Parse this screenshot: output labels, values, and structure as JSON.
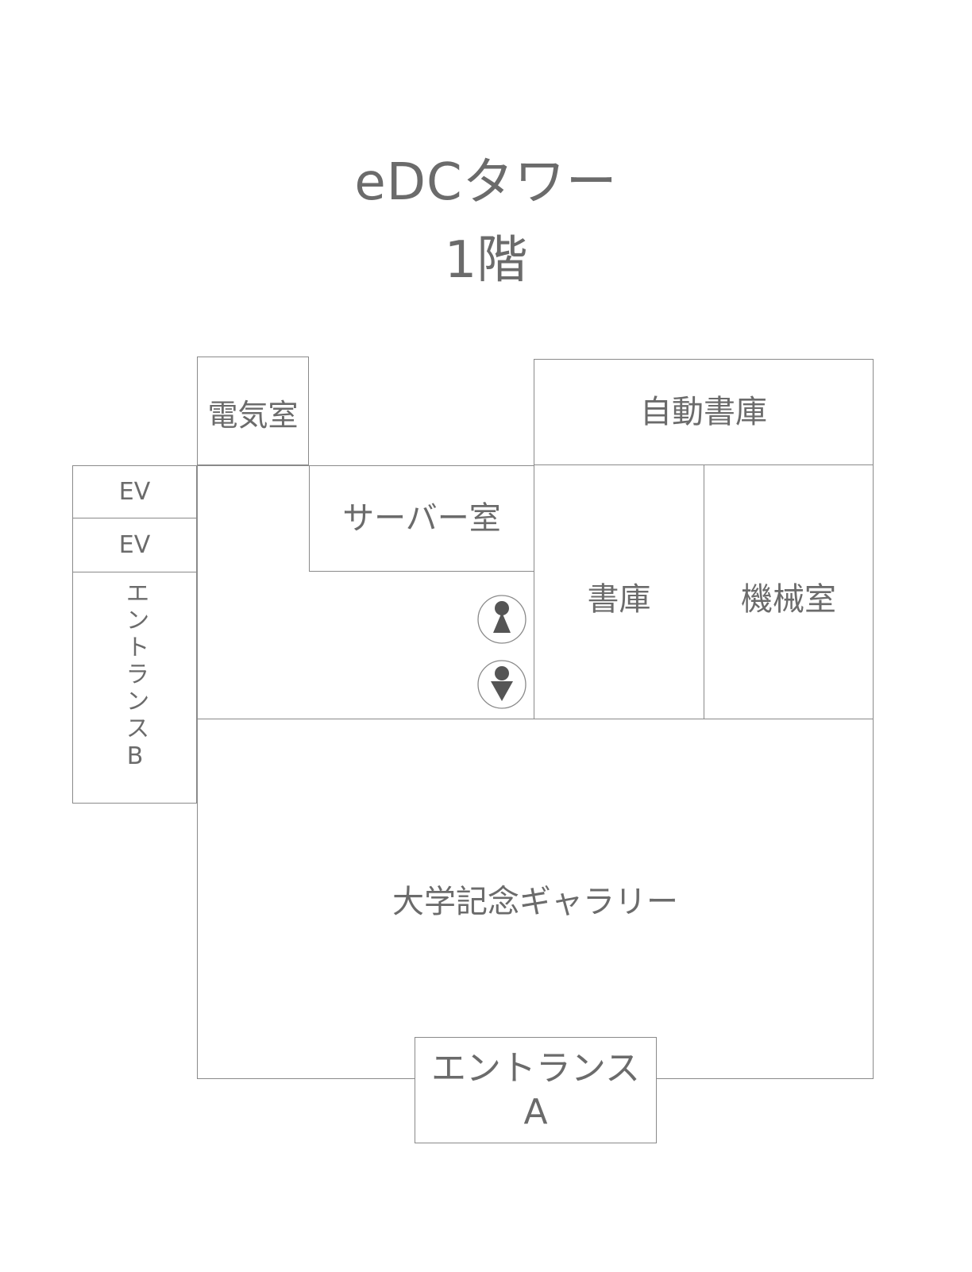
{
  "title": {
    "building": "eDCタワー",
    "floor": "1階"
  },
  "rooms": {
    "electrical": "電気室",
    "auto_library": "自動書庫",
    "ev1": "EV",
    "ev2": "EV",
    "server": "サーバー室",
    "library": "書庫",
    "machine": "機械室",
    "entrance_b": "エントランスB",
    "gallery": "大学記念ギャラリー",
    "entrance_a_line1": "エントランス",
    "entrance_a_line2": "A"
  },
  "icons": {
    "restroom_women": "restroom-women-icon",
    "restroom_men": "restroom-men-icon"
  },
  "colors": {
    "line": "#8a8a8a",
    "text": "#6b6b6b",
    "icon_fill": "#555555"
  }
}
